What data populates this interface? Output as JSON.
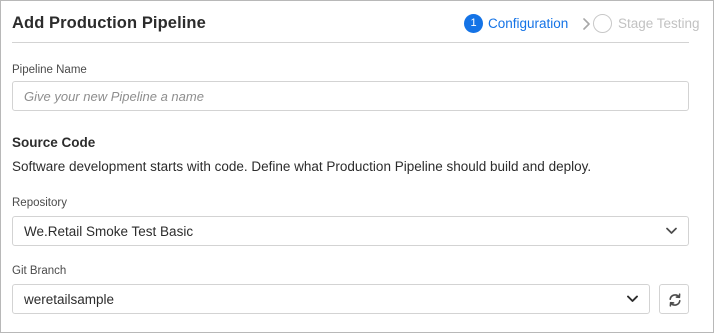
{
  "dialog": {
    "title": "Add Production Pipeline"
  },
  "stepper": {
    "steps": [
      {
        "number": "1",
        "label": "Configuration",
        "active": true
      },
      {
        "number": "",
        "label": "Stage Testing",
        "active": false
      }
    ]
  },
  "pipeline_name": {
    "label": "Pipeline Name",
    "value": "",
    "placeholder": "Give your new Pipeline a name"
  },
  "source_code": {
    "heading": "Source Code",
    "description": "Software development starts with code. Define what Production Pipeline should build and deploy."
  },
  "repository": {
    "label": "Repository",
    "selected": "We.Retail Smoke Test Basic"
  },
  "git_branch": {
    "label": "Git Branch",
    "selected": "weretailsample",
    "refresh_icon": "refresh-icon"
  },
  "colors": {
    "accent": "#1473e6",
    "inactive_step": "#c2c2c2",
    "border": "#d3d3d3",
    "text": "#2c2c2c"
  }
}
